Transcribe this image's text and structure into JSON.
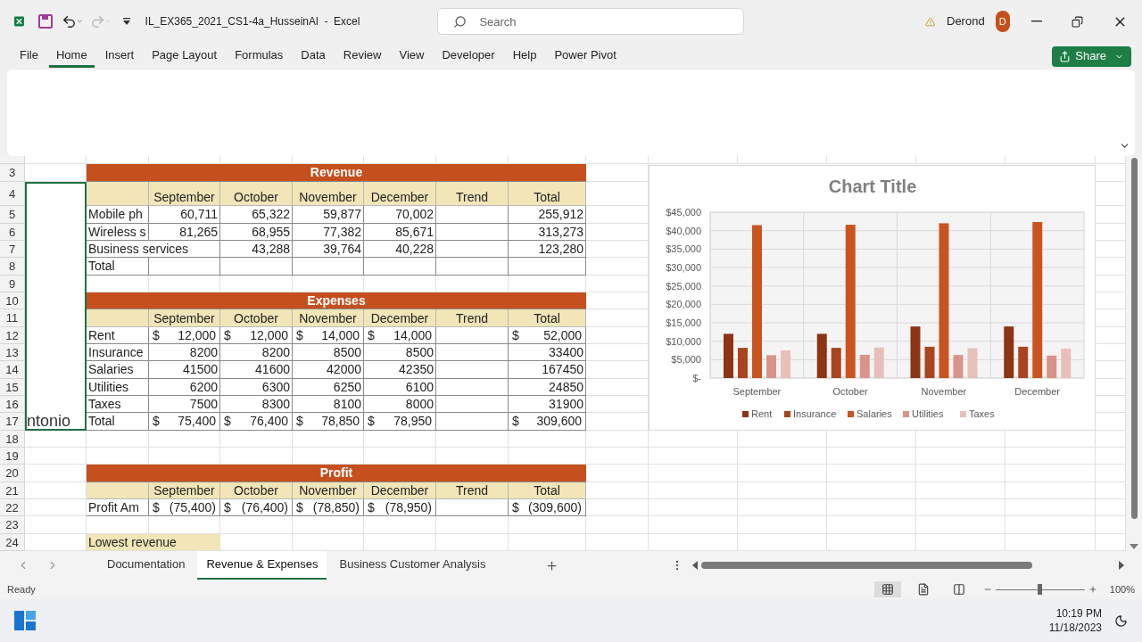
{
  "title_bar": {
    "file_name": "IL_EX365_2021_CS1-4a_HusseinAl",
    "separator": "-",
    "app": "Excel",
    "search_placeholder": "Search",
    "user": "Derond",
    "avatar_initial": "D",
    "redo_disabled": true
  },
  "ribbon_tabs": [
    {
      "label": "File",
      "selected": false
    },
    {
      "label": "Home",
      "selected": true
    },
    {
      "label": "Insert",
      "selected": false
    },
    {
      "label": "Page Layout",
      "selected": false
    },
    {
      "label": "Formulas",
      "selected": false
    },
    {
      "label": "Data",
      "selected": false
    },
    {
      "label": "Review",
      "selected": false
    },
    {
      "label": "View",
      "selected": false
    },
    {
      "label": "Developer",
      "selected": false
    },
    {
      "label": "Help",
      "selected": false
    },
    {
      "label": "Power Pivot",
      "selected": false
    }
  ],
  "share_button": "Share",
  "sheet": {
    "rows": [
      {
        "number": "3",
        "kind": "banner",
        "selected": false,
        "title": "Revenue"
      },
      {
        "number": "4",
        "kind": "header",
        "selected": true,
        "cells": [
          null,
          "September",
          "October",
          "November",
          "December",
          "Trend",
          "Total"
        ]
      },
      {
        "number": "5",
        "kind": "data",
        "selected": true,
        "cells": [
          "Mobile ph",
          "60,711",
          "65,322",
          "59,877",
          "70,002",
          null,
          "255,912"
        ]
      },
      {
        "number": "6",
        "kind": "data",
        "selected": true,
        "cells": [
          "Wireless s",
          "81,265",
          "68,955",
          "77,382",
          "85,671",
          null,
          "313,273"
        ]
      },
      {
        "number": "7",
        "kind": "data",
        "selected": true,
        "cells": [
          {
            "text": "Business services",
            "overflow": true
          },
          "43,288",
          "39,764",
          "40,228",
          null,
          "123,280"
        ]
      },
      {
        "number": "8",
        "kind": "data",
        "selected": true,
        "cells": [
          "Total",
          null,
          null,
          null,
          null,
          null,
          null
        ]
      },
      {
        "number": "9",
        "kind": "empty",
        "selected": true
      },
      {
        "number": "10",
        "kind": "banner",
        "selected": true,
        "title": "Expenses"
      },
      {
        "number": "11",
        "kind": "header",
        "selected": true,
        "cells": [
          null,
          "September",
          "October",
          "November",
          "December",
          "Trend",
          "Total"
        ]
      },
      {
        "number": "12",
        "kind": "data",
        "selected": true,
        "cells": [
          "Rent",
          {
            "symbol": "$",
            "amount": "12,000"
          },
          {
            "symbol": "$",
            "amount": "12,000"
          },
          {
            "symbol": "$",
            "amount": "14,000"
          },
          {
            "symbol": "$",
            "amount": "14,000"
          },
          null,
          {
            "symbol": "$",
            "amount": "52,000"
          }
        ]
      },
      {
        "number": "13",
        "kind": "data",
        "selected": true,
        "cells": [
          "Insurance",
          "8200",
          "8200",
          "8500",
          "8500",
          null,
          "33400"
        ]
      },
      {
        "number": "14",
        "kind": "data",
        "selected": true,
        "cells": [
          "Salaries",
          "41500",
          "41600",
          "42000",
          "42350",
          null,
          "167450"
        ]
      },
      {
        "number": "15",
        "kind": "data",
        "selected": true,
        "cells": [
          "Utilities",
          "6200",
          "6300",
          "6250",
          "6100",
          null,
          "24850"
        ]
      },
      {
        "number": "16",
        "kind": "data",
        "selected": true,
        "cells": [
          "Taxes",
          "7500",
          "8300",
          "8100",
          "8000",
          null,
          "31900"
        ]
      },
      {
        "number": "17",
        "kind": "data",
        "selected": true,
        "a_text": "ntonio",
        "cells": [
          "Total",
          {
            "symbol": "$",
            "amount": "75,400"
          },
          {
            "symbol": "$",
            "amount": "76,400"
          },
          {
            "symbol": "$",
            "amount": "78,850"
          },
          {
            "symbol": "$",
            "amount": "78,950"
          },
          null,
          {
            "symbol": "$",
            "amount": "309,600"
          }
        ]
      },
      {
        "number": "18",
        "kind": "empty",
        "selected": false
      },
      {
        "number": "19",
        "kind": "empty",
        "selected": false
      },
      {
        "number": "20",
        "kind": "banner",
        "selected": false,
        "title": "Profit"
      },
      {
        "number": "21",
        "kind": "header",
        "selected": false,
        "cells": [
          null,
          "September",
          "October",
          "November",
          "December",
          "Trend",
          "Total"
        ]
      },
      {
        "number": "22",
        "kind": "data",
        "selected": false,
        "cells": [
          "Profit Am",
          {
            "symbol": "$",
            "amount": "(75,400)"
          },
          {
            "symbol": "$",
            "amount": "(76,400)"
          },
          {
            "symbol": "$",
            "amount": "(78,850)"
          },
          {
            "symbol": "$",
            "amount": "(78,950)"
          },
          null,
          {
            "symbol": "$",
            "amount": "(309,600)"
          }
        ]
      },
      {
        "number": "23",
        "kind": "empty",
        "selected": false
      },
      {
        "number": "24",
        "kind": "note",
        "selected": false,
        "text": "Lowest revenue"
      }
    ]
  },
  "chart": {
    "chart_data": {
      "type": "bar",
      "title": "Chart Title",
      "categories": [
        "September",
        "October",
        "November",
        "December"
      ],
      "series": [
        {
          "name": "Rent",
          "color": "#8c3414",
          "values": [
            12000,
            12000,
            14000,
            14000
          ]
        },
        {
          "name": "Insurance",
          "color": "#a9441f",
          "values": [
            8200,
            8200,
            8500,
            8500
          ]
        },
        {
          "name": "Salaries",
          "color": "#c9541f",
          "values": [
            41500,
            41600,
            42000,
            42350
          ]
        },
        {
          "name": "Utilities",
          "color": "#d9938a",
          "values": [
            6200,
            6300,
            6250,
            6100
          ]
        },
        {
          "name": "Taxes",
          "color": "#e8c0b9",
          "values": [
            7500,
            8300,
            8100,
            8000
          ]
        }
      ],
      "ylim": [
        0,
        45000
      ],
      "grid": true,
      "legend": true,
      "yticks": [
        {
          "value": 0,
          "label": "$-"
        },
        {
          "value": 5000,
          "label": "$5,000"
        },
        {
          "value": 10000,
          "label": "$10,000"
        },
        {
          "value": 15000,
          "label": "$15,000"
        },
        {
          "value": 20000,
          "label": "$20,000"
        },
        {
          "value": 25000,
          "label": "$25,000"
        },
        {
          "value": 30000,
          "label": "$30,000"
        },
        {
          "value": 35000,
          "label": "$35,000"
        },
        {
          "value": 40000,
          "label": "$40,000"
        },
        {
          "value": 45000,
          "label": "$45,000"
        }
      ]
    }
  },
  "sheet_tabs": [
    {
      "label": "Documentation",
      "selected": false
    },
    {
      "label": "Revenue & Expenses",
      "selected": true
    },
    {
      "label": "Business Customer Analysis",
      "selected": false
    }
  ],
  "status_bar": {
    "ready": "Ready",
    "views": [
      {
        "kind": "normal",
        "selected": true
      },
      {
        "kind": "page_layout",
        "selected": false
      },
      {
        "kind": "page_break",
        "selected": false
      }
    ],
    "zoom": {
      "level": 0.5
    },
    "zoom_label": "100%"
  },
  "taskbar": {
    "time": "10:19 PM",
    "date": "11/18/2023"
  }
}
